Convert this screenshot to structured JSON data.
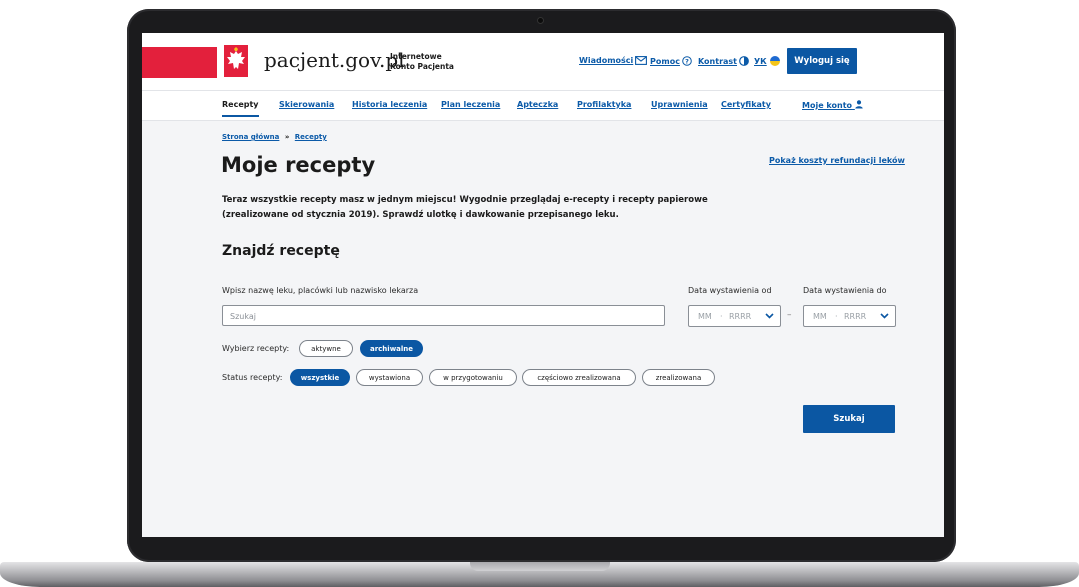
{
  "header": {
    "logo_text": "pacjent.gov.pl",
    "logo_sub_line1": "Internetowe",
    "logo_sub_line2": "Konto Pacjenta",
    "links": {
      "messages": "Wiadomości",
      "help": "Pomoc",
      "contrast": "Kontrast",
      "language": "УК"
    },
    "logout_label": "Wyloguj się"
  },
  "nav": {
    "items": [
      {
        "label": "Recepty"
      },
      {
        "label": "Skierowania"
      },
      {
        "label": "Historia leczenia"
      },
      {
        "label": "Plan leczenia"
      },
      {
        "label": "Apteczka"
      },
      {
        "label": "Profilaktyka"
      },
      {
        "label": "Uprawnienia"
      },
      {
        "label": "Certyfikaty"
      },
      {
        "label": "Moje konto"
      }
    ]
  },
  "breadcrumb": {
    "home": "Strona główna",
    "separator": "»",
    "current": "Recepty"
  },
  "page": {
    "title": "Moje recepty",
    "refund_link": "Pokaż koszty refundacji leków",
    "intro": "Teraz wszystkie recepty masz w jednym miejscu! Wygodnie przeglądaj e-recepty i recepty papierowe (zrealizowane od stycznia 2019). Sprawdź ulotkę i dawkowanie przepisanego leku.",
    "section_title": "Znajdź receptę"
  },
  "search": {
    "label": "Wpisz nazwę leku, placówki lub nazwisko lekarza",
    "placeholder": "Szukaj",
    "date_from_label": "Data wystawienia od",
    "date_to_label": "Data wystawienia do",
    "date_month_placeholder": "MM",
    "date_year_placeholder": "RRRR",
    "date_separator": "–",
    "type_label": "Wybierz recepty:",
    "types": [
      {
        "label": "aktywne",
        "selected": false
      },
      {
        "label": "archiwalne",
        "selected": true
      }
    ],
    "status_label": "Status recepty:",
    "statuses": [
      {
        "label": "wszystkie",
        "selected": true
      },
      {
        "label": "wystawiona",
        "selected": false
      },
      {
        "label": "w przygotowaniu",
        "selected": false
      },
      {
        "label": "częściowo zrealizowana",
        "selected": false
      },
      {
        "label": "zrealizowana",
        "selected": false
      }
    ],
    "submit_label": "Szukaj"
  },
  "colors": {
    "primary": "#0b57a3",
    "flag_red": "#e3203c",
    "link": "#0b5aa8"
  }
}
